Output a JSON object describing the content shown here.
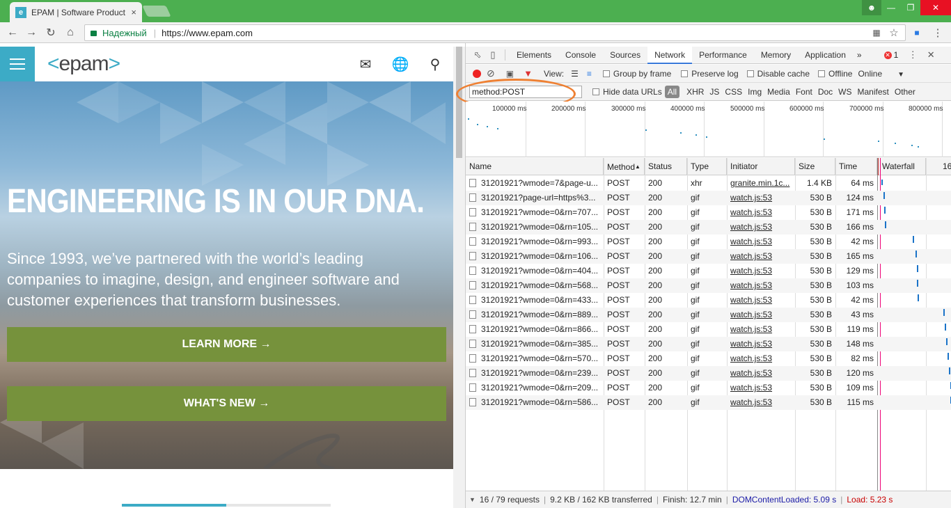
{
  "browser": {
    "tab_title": "EPAM | Software Product",
    "tab_close": "×",
    "favicon": "e",
    "security_label": "Надежный",
    "url": "https://www.epam.com"
  },
  "site": {
    "logo_text": "epam",
    "hero_title": "ENGINEERING IS IN OUR DNA.",
    "hero_text": "Since 1993, we’ve partnered with the world’s leading companies to imagine, design, and engineer software and customer experiences that transform businesses.",
    "btn_learn": "LEARN MORE →",
    "btn_new": "WHAT'S NEW →",
    "brand_color": "#3cabc6",
    "button_color": "#76923c"
  },
  "devtools": {
    "tabs": [
      "Elements",
      "Console",
      "Sources",
      "Network",
      "Performance",
      "Memory",
      "Application"
    ],
    "more": "»",
    "error_count": "1",
    "view_label": "View:",
    "group_by_frame": "Group by frame",
    "preserve_log": "Preserve log",
    "disable_cache": "Disable cache",
    "offline": "Offline",
    "online": "Online",
    "filter_value": "method:POST",
    "hide_data_urls": "Hide data URLs",
    "types": [
      "All",
      "XHR",
      "JS",
      "CSS",
      "Img",
      "Media",
      "Font",
      "Doc",
      "WS",
      "Manifest",
      "Other"
    ],
    "overview_labels": [
      "100000 ms",
      "200000 ms",
      "300000 ms",
      "400000 ms",
      "500000 ms",
      "600000 ms",
      "700000 ms",
      "800000 ms"
    ],
    "columns": {
      "name": "Name",
      "method": "Method",
      "status": "Status",
      "type": "Type",
      "initiator": "Initiator",
      "size": "Size",
      "time": "Time",
      "waterfall": "Waterfall",
      "wf_extra": "16"
    },
    "requests": [
      {
        "name": "31201921?wmode=7&page-u...",
        "method": "POST",
        "status": "200",
        "type": "xhr",
        "initiator": "granite.min.1c...",
        "size": "1.4 KB",
        "time": "64 ms"
      },
      {
        "name": "31201921?page-url=https%3...",
        "method": "POST",
        "status": "200",
        "type": "gif",
        "initiator": "watch.js:53",
        "size": "530 B",
        "time": "124 ms"
      },
      {
        "name": "31201921?wmode=0&rn=707...",
        "method": "POST",
        "status": "200",
        "type": "gif",
        "initiator": "watch.js:53",
        "size": "530 B",
        "time": "171 ms"
      },
      {
        "name": "31201921?wmode=0&rn=105...",
        "method": "POST",
        "status": "200",
        "type": "gif",
        "initiator": "watch.js:53",
        "size": "530 B",
        "time": "166 ms"
      },
      {
        "name": "31201921?wmode=0&rn=993...",
        "method": "POST",
        "status": "200",
        "type": "gif",
        "initiator": "watch.js:53",
        "size": "530 B",
        "time": "42 ms"
      },
      {
        "name": "31201921?wmode=0&rn=106...",
        "method": "POST",
        "status": "200",
        "type": "gif",
        "initiator": "watch.js:53",
        "size": "530 B",
        "time": "165 ms"
      },
      {
        "name": "31201921?wmode=0&rn=404...",
        "method": "POST",
        "status": "200",
        "type": "gif",
        "initiator": "watch.js:53",
        "size": "530 B",
        "time": "129 ms"
      },
      {
        "name": "31201921?wmode=0&rn=568...",
        "method": "POST",
        "status": "200",
        "type": "gif",
        "initiator": "watch.js:53",
        "size": "530 B",
        "time": "103 ms"
      },
      {
        "name": "31201921?wmode=0&rn=433...",
        "method": "POST",
        "status": "200",
        "type": "gif",
        "initiator": "watch.js:53",
        "size": "530 B",
        "time": "42 ms"
      },
      {
        "name": "31201921?wmode=0&rn=889...",
        "method": "POST",
        "status": "200",
        "type": "gif",
        "initiator": "watch.js:53",
        "size": "530 B",
        "time": "43 ms"
      },
      {
        "name": "31201921?wmode=0&rn=866...",
        "method": "POST",
        "status": "200",
        "type": "gif",
        "initiator": "watch.js:53",
        "size": "530 B",
        "time": "119 ms"
      },
      {
        "name": "31201921?wmode=0&rn=385...",
        "method": "POST",
        "status": "200",
        "type": "gif",
        "initiator": "watch.js:53",
        "size": "530 B",
        "time": "148 ms"
      },
      {
        "name": "31201921?wmode=0&rn=570...",
        "method": "POST",
        "status": "200",
        "type": "gif",
        "initiator": "watch.js:53",
        "size": "530 B",
        "time": "82 ms"
      },
      {
        "name": "31201921?wmode=0&rn=239...",
        "method": "POST",
        "status": "200",
        "type": "gif",
        "initiator": "watch.js:53",
        "size": "530 B",
        "time": "120 ms"
      },
      {
        "name": "31201921?wmode=0&rn=209...",
        "method": "POST",
        "status": "200",
        "type": "gif",
        "initiator": "watch.js:53",
        "size": "530 B",
        "time": "109 ms"
      },
      {
        "name": "31201921?wmode=0&rn=586...",
        "method": "POST",
        "status": "200",
        "type": "gif",
        "initiator": "watch.js:53",
        "size": "530 B",
        "time": "115 ms"
      }
    ],
    "status_bar": {
      "requests": "16 / 79 requests",
      "transferred": "9.2 KB / 162 KB transferred",
      "finish": "Finish: 12.7 min",
      "dom": "DOMContentLoaded: 5.09 s",
      "load": "Load: 5.23 s"
    }
  }
}
